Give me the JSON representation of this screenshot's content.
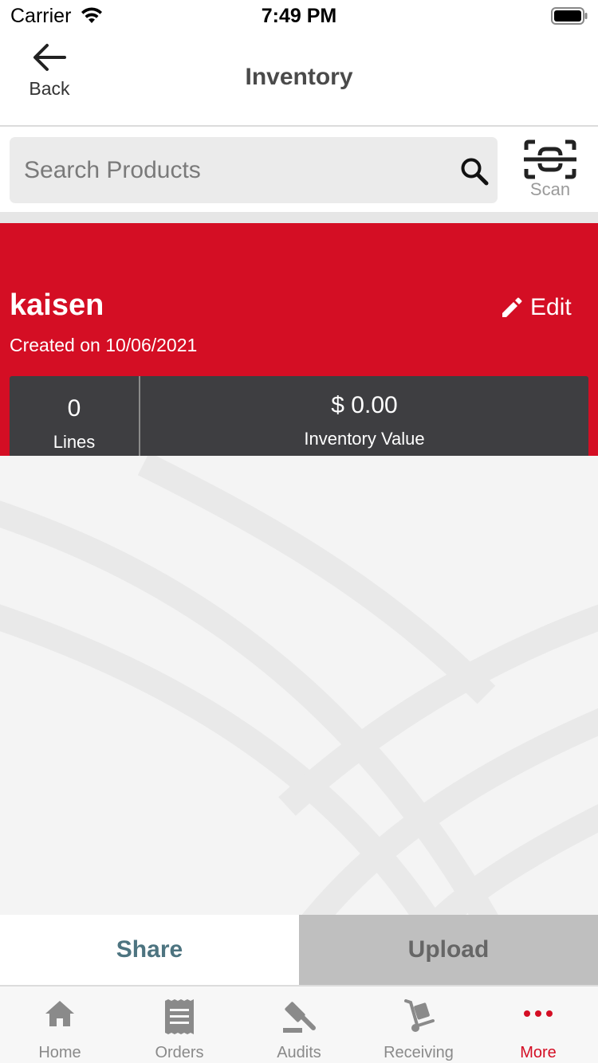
{
  "status_bar": {
    "carrier": "Carrier",
    "time": "7:49 PM"
  },
  "nav": {
    "back_label": "Back",
    "title": "Inventory"
  },
  "search": {
    "placeholder": "Search Products",
    "value": "",
    "scan_label": "Scan"
  },
  "inventory": {
    "name": "kaisen",
    "created": "Created on 10/06/2021",
    "edit_label": "Edit",
    "lines_value": "0",
    "lines_label": "Lines",
    "value_amount": "$ 0.00",
    "value_label": "Inventory Value"
  },
  "actions": {
    "share_label": "Share",
    "upload_label": "Upload"
  },
  "tabs": [
    {
      "label": "Home",
      "icon": "home-icon"
    },
    {
      "label": "Orders",
      "icon": "orders-icon"
    },
    {
      "label": "Audits",
      "icon": "gavel-icon"
    },
    {
      "label": "Receiving",
      "icon": "hand-truck-icon"
    },
    {
      "label": "More",
      "icon": "more-icon",
      "active": true
    }
  ],
  "colors": {
    "brand_red": "#d40e24",
    "stats_card": "#3e3e41",
    "share_text": "#4d7480",
    "upload_bg": "#bfbfbf"
  }
}
